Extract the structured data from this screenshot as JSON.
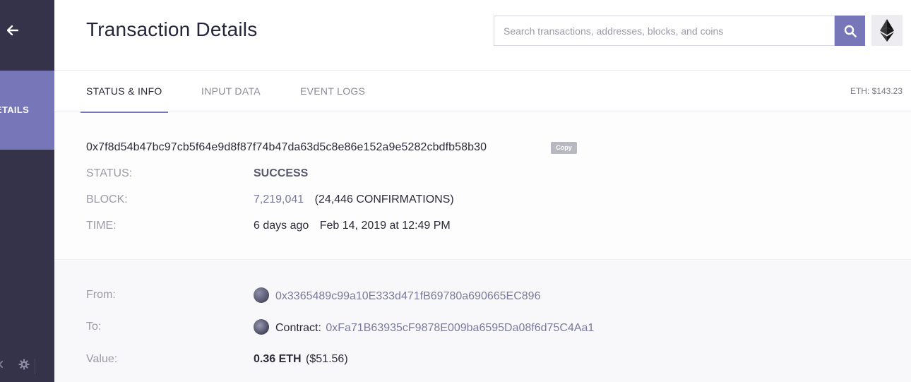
{
  "sidebar": {
    "active_label": "ETAILS"
  },
  "header": {
    "title": "Transaction Details",
    "search_placeholder": "Search transactions, addresses, blocks, and coins"
  },
  "tabs": [
    {
      "label": "STATUS & INFO"
    },
    {
      "label": "INPUT DATA"
    },
    {
      "label": "EVENT LOGS"
    }
  ],
  "price": "ETH: $143.23",
  "tx": {
    "hash": "0x7f8d54b47bc97cb5f64e9d8f87f74b47da63d5c8e86e152a9e5282cbdfb58b30",
    "copy_label": "Copy",
    "status_label": "STATUS:",
    "status_value": "SUCCESS",
    "block_label": "BLOCK:",
    "block_number": "7,219,041",
    "confirmations": "(24,446 CONFIRMATIONS)",
    "time_label": "TIME:",
    "time_ago": "6 days ago",
    "time_date": "Feb 14, 2019 at 12:49 PM"
  },
  "transfer": {
    "from_label": "From:",
    "from_address": "0x3365489c99a10E333d471fB69780a690665EC896",
    "to_label": "To:",
    "to_prefix": "Contract:",
    "to_address": "0xFa71B63935cF9878E009ba6595Da08f6d75C4Aa1",
    "value_label": "Value:",
    "value_eth": "0.36 ETH",
    "value_usd": "($51.56)"
  },
  "colors": {
    "sidebar": "#34334a",
    "accent": "#7676b8"
  }
}
